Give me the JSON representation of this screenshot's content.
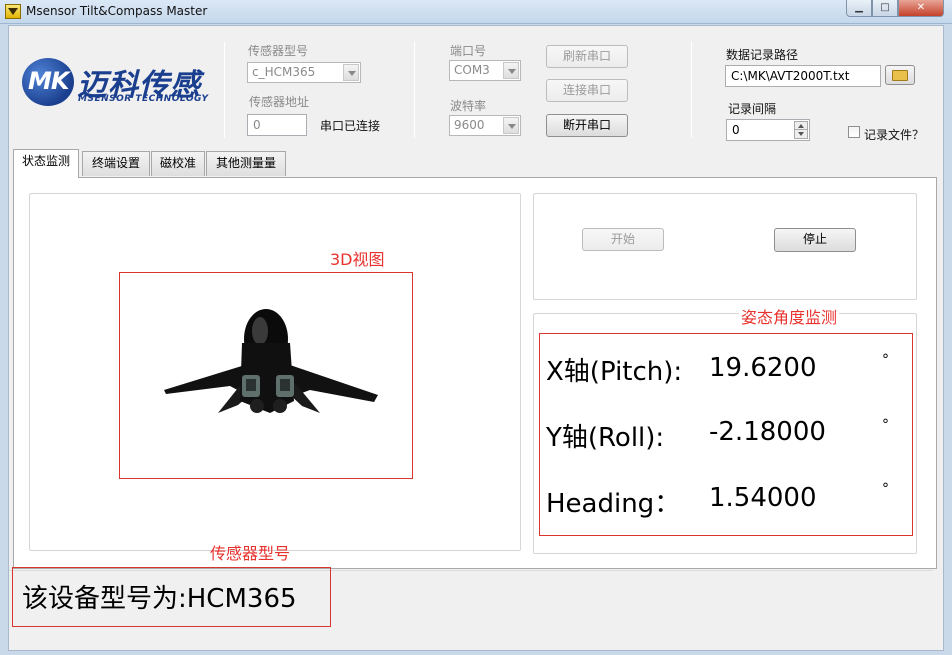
{
  "window": {
    "title": "Msensor Tilt&Compass Master",
    "minimize": "▁",
    "maximize": "□",
    "close": "✕"
  },
  "logo": {
    "mark": "MK",
    "brand_cn": "迈科传感",
    "brand_en": "MSENSOR TECHNOLOGY"
  },
  "sensor": {
    "model_label": "传感器型号",
    "model_value": "c_HCM365",
    "address_label": "传感器地址",
    "address_value": "0",
    "status": "串口已连接"
  },
  "serial": {
    "port_label": "端口号",
    "port_value": "COM3",
    "baud_label": "波特率",
    "baud_value": "9600",
    "refresh_label": "刷新串口",
    "connect_label": "连接串口",
    "disconnect_label": "断开串口"
  },
  "logging": {
    "path_label": "数据记录路径",
    "path_value": "C:\\MK\\AVT2000T.txt",
    "interval_label": "记录间隔",
    "interval_value": "0",
    "record_label": "记录文件？",
    "record_checked": false
  },
  "tabs": [
    {
      "label": "状态监测",
      "active": true
    },
    {
      "label": "终端设置",
      "active": false
    },
    {
      "label": "磁校准",
      "active": false
    },
    {
      "label": "其他测量量",
      "active": false
    }
  ],
  "view3d": {
    "caption": "3D视图"
  },
  "controls": {
    "start_label": "开始",
    "stop_label": "停止"
  },
  "attitude": {
    "caption": "姿态角度监测",
    "rows": [
      {
        "label": "X轴(Pitch):",
        "value": "19.6200",
        "unit": "°"
      },
      {
        "label": "Y轴(Roll):",
        "value": "-2.18000",
        "unit": "°"
      },
      {
        "label": "Heading：",
        "value": "1.54000",
        "unit": "°"
      }
    ]
  },
  "model_info": {
    "caption": "传感器型号",
    "text": "该设备型号为:HCM365"
  },
  "colors": {
    "annotation_red": "#e8322e",
    "logo_blue": "#1b3f8f"
  }
}
